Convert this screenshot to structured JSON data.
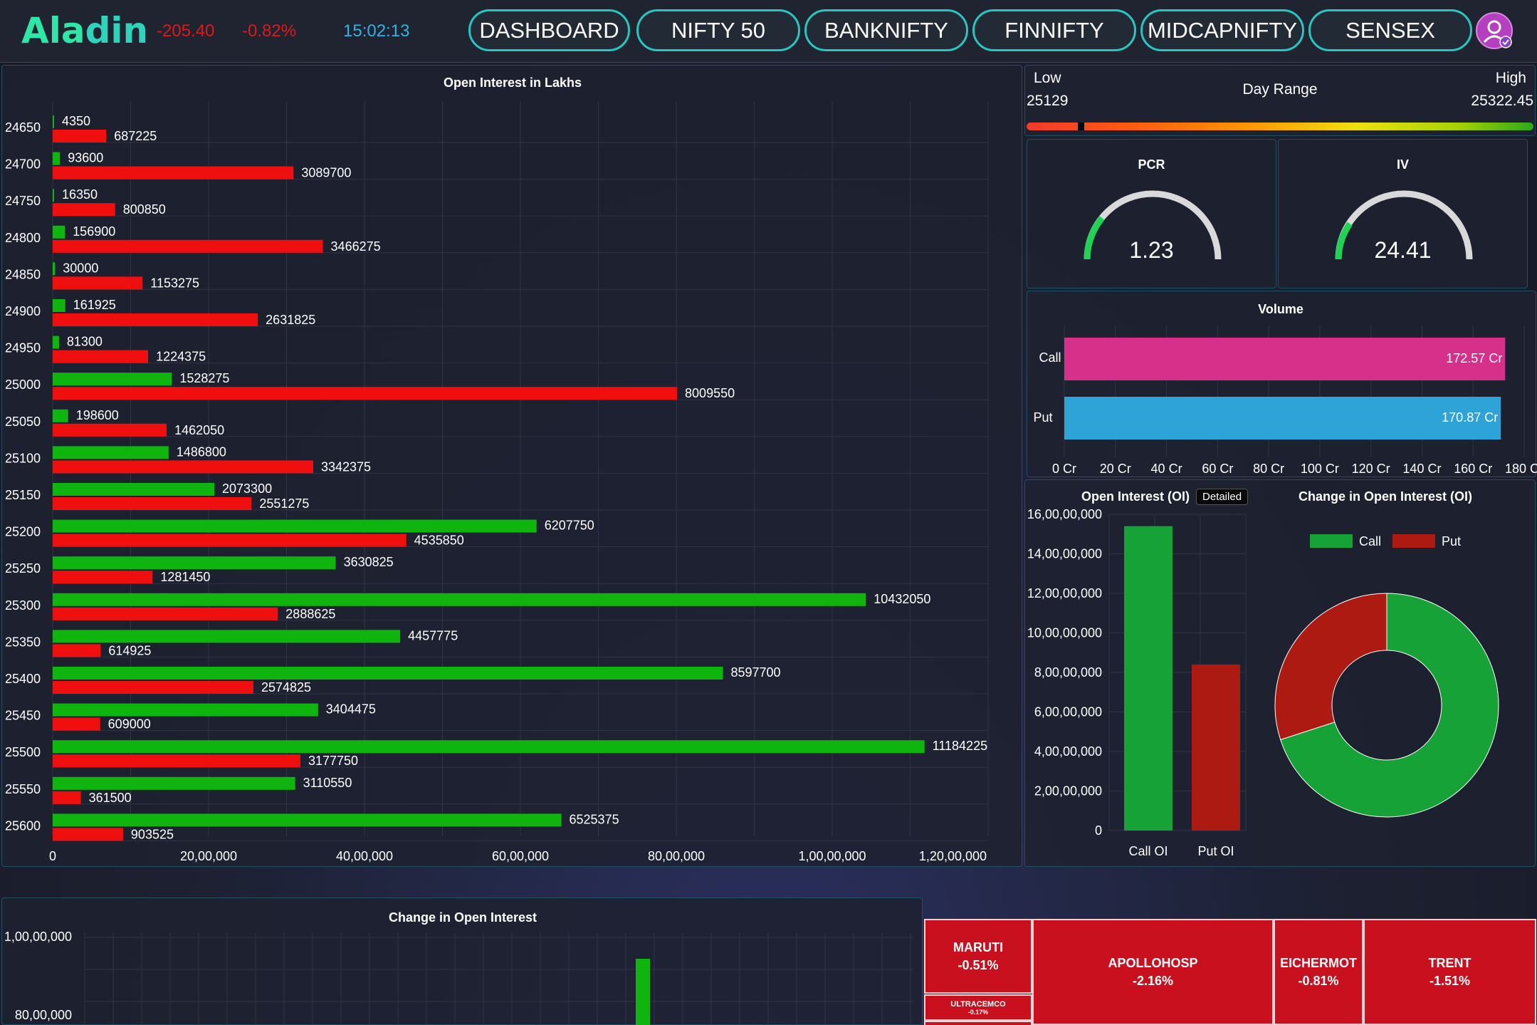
{
  "header": {
    "logo": "Aladin",
    "change": "-205.40",
    "change_pct": "-0.82%",
    "time": "15:02:13",
    "nav": [
      "DASHBOARD",
      "NIFTY 50",
      "BANKNIFTY",
      "FINNIFTY",
      "MIDCAPNIFTY",
      "SENSEX"
    ],
    "avatar_icon": "user-avatar-icon"
  },
  "oi_chart": {
    "title": "Open Interest in Lakhs",
    "x_ticks": [
      "0",
      "20,00,000",
      "40,00,000",
      "60,00,000",
      "80,00,000",
      "1,00,00,000",
      "1,20,00,000"
    ]
  },
  "day_range": {
    "low_label": "Low",
    "high_label": "High",
    "title": "Day Range",
    "low_value": "25129",
    "high_value": "25322.45"
  },
  "pcr": {
    "title": "PCR",
    "value": "1.23"
  },
  "iv": {
    "title": "IV",
    "value": "24.41"
  },
  "volume": {
    "title": "Volume",
    "call_label": "Call",
    "put_label": "Put",
    "call_value": "172.57 Cr",
    "put_value": "170.87 Cr",
    "x_ticks": [
      "0 Cr",
      "20 Cr",
      "40 Cr",
      "60 Cr",
      "80 Cr",
      "100 Cr",
      "120 Cr",
      "140 Cr",
      "160 Cr",
      "180 Cr"
    ]
  },
  "oi_summary": {
    "title": "Open Interest (OI)",
    "detailed_label": "Detailed",
    "y_ticks": [
      "16,00,00,000",
      "14,00,00,000",
      "12,00,00,000",
      "10,00,00,000",
      "8,00,00,000",
      "6,00,00,000",
      "4,00,00,000",
      "2,00,00,000",
      "0"
    ],
    "bar_labels": [
      "Call OI",
      "Put OI"
    ]
  },
  "change_oi_donut": {
    "title": "Change in Open Interest (OI)",
    "legend": [
      "Call",
      "Put"
    ]
  },
  "change_oi_chart": {
    "title": "Change in Open Interest",
    "y_ticks": [
      "1,00,00,000",
      "80,00,000"
    ]
  },
  "treemap": [
    {
      "name": "MARUTI",
      "pct": "-0.51%"
    },
    {
      "name": "ULTRACEMCO",
      "pct": "-0.17%"
    },
    {
      "name": "APOLLOHOSP",
      "pct": "-2.16%"
    },
    {
      "name": "EICHERMOT",
      "pct": "-0.81%"
    },
    {
      "name": "TRENT",
      "pct": "-1.51%"
    }
  ],
  "colors": {
    "call": "#0fb40f",
    "put": "#f00f0f",
    "accent": "#27c6c0",
    "volume_call": "#d6308a",
    "volume_put": "#2ea3d8",
    "oi_call": "#16a236",
    "oi_put": "#ad1a12"
  },
  "chart_data": [
    {
      "type": "bar",
      "title": "Open Interest in Lakhs",
      "orientation": "horizontal",
      "categories": [
        "24650",
        "24700",
        "24750",
        "24800",
        "24850",
        "24900",
        "24950",
        "25000",
        "25050",
        "25100",
        "25150",
        "25200",
        "25250",
        "25300",
        "25350",
        "25400",
        "25450",
        "25500",
        "25550",
        "25600"
      ],
      "series": [
        {
          "values": [
            4350,
            93600,
            16350,
            156900,
            30000,
            161925,
            81300,
            1528275,
            198600,
            1486800,
            2073300,
            6207750,
            3630825,
            10432050,
            4457775,
            8597700,
            3404475,
            11184225,
            3110550,
            6525375
          ]
        },
        {
          "values": [
            687225,
            3089700,
            800850,
            3466275,
            1153275,
            2631825,
            1224375,
            8009550,
            1462050,
            3342375,
            2551275,
            4535850,
            1281450,
            2888625,
            614925,
            2574825,
            609000,
            3177750,
            361500,
            903525
          ]
        }
      ],
      "xlim": [
        0,
        12000000
      ]
    },
    {
      "type": "bar",
      "title": "Volume",
      "orientation": "horizontal",
      "categories": [
        "Call",
        "Put"
      ],
      "values": [
        172.57,
        170.87
      ],
      "xlim": [
        0,
        180
      ]
    },
    {
      "type": "bar",
      "title": "Open Interest (OI)",
      "categories": [
        "Call OI",
        "Put OI"
      ],
      "values": [
        154000000,
        84000000
      ],
      "ylim": [
        0,
        160000000
      ]
    },
    {
      "type": "pie",
      "title": "Change in Open Interest (OI)",
      "categories": [
        "Call",
        "Put"
      ],
      "values": [
        70,
        30
      ]
    },
    {
      "type": "bar",
      "title": "Change in Open Interest",
      "ylim": [
        70000000,
        100000000
      ]
    }
  ]
}
